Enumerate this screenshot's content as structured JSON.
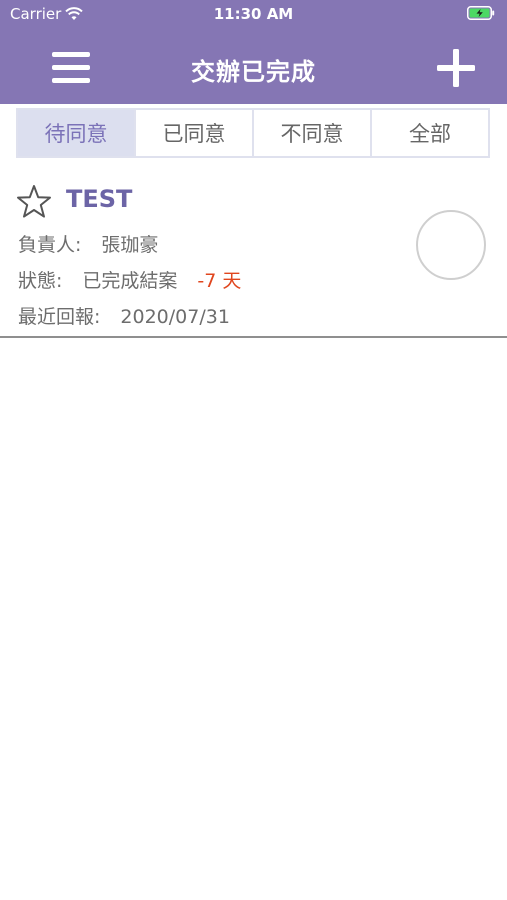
{
  "status_bar": {
    "carrier": "Carrier",
    "time": "11:30 AM"
  },
  "nav": {
    "title": "交辦已完成"
  },
  "tabs": [
    {
      "label": "待同意",
      "active": true
    },
    {
      "label": "已同意",
      "active": false
    },
    {
      "label": "不同意",
      "active": false
    },
    {
      "label": "全部",
      "active": false
    }
  ],
  "items": [
    {
      "title": "TEST",
      "owner_label": "負責人:",
      "owner": "張珈豪",
      "status_label": "狀態:",
      "status": "已完成結案",
      "days": "-7 天",
      "report_label": "最近回報:",
      "report_date": "2020/07/31"
    }
  ],
  "colors": {
    "header": "#8576b4",
    "accent": "#6c64a6",
    "alert": "#e0461e",
    "tab_active_bg": "#dcdfef"
  },
  "icons": [
    "wifi-icon",
    "battery-charging-icon",
    "menu-icon",
    "add-icon",
    "star-outline-icon"
  ]
}
